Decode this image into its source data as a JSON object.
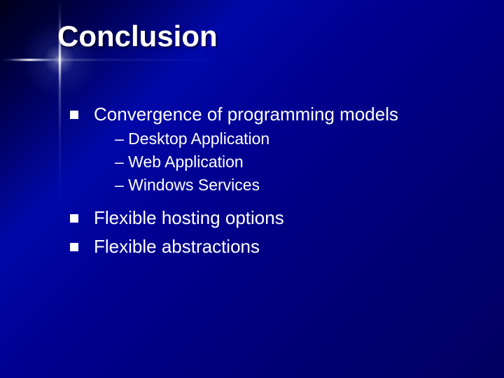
{
  "title": "Conclusion",
  "bullets": {
    "b1": {
      "text": "Convergence of programming models",
      "sub": [
        "– Desktop Application",
        "– Web Application",
        "– Windows Services"
      ]
    },
    "b2": {
      "text": "Flexible hosting options"
    },
    "b3": {
      "text": "Flexible abstractions"
    }
  }
}
